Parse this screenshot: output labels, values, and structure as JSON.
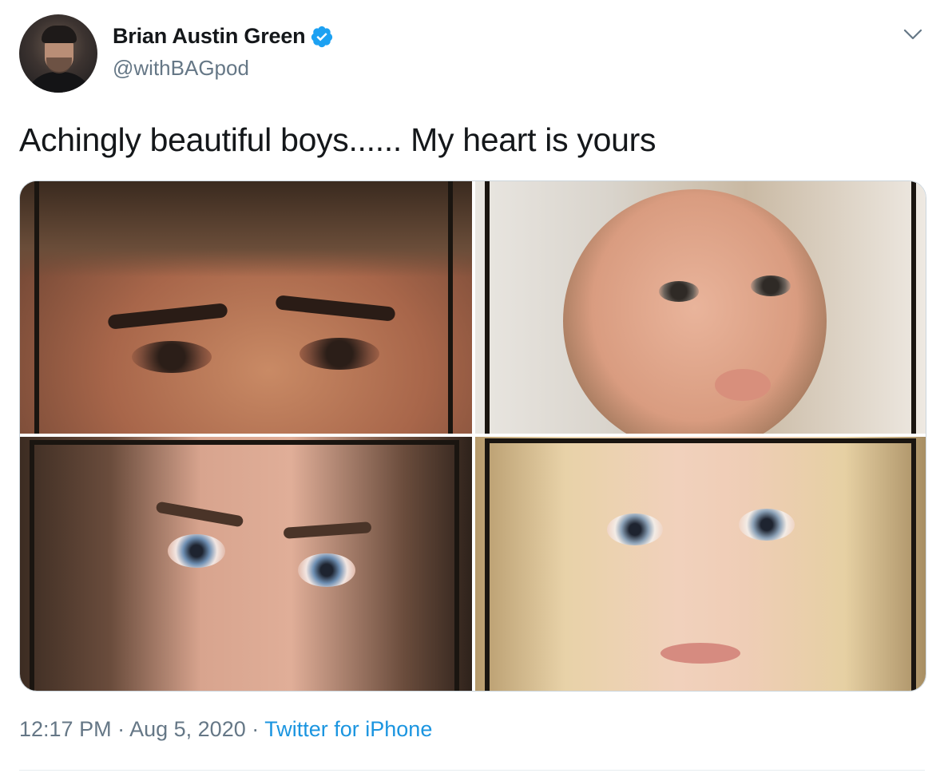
{
  "author": {
    "name": "Brian Austin Green",
    "handle": "@withBAGpod",
    "verified": true,
    "avatar_icon": "profile-photo"
  },
  "tweet": {
    "text": "Achingly beautiful boys...... My heart is yours"
  },
  "media": {
    "count": 4,
    "photos": [
      "photo-1",
      "photo-2",
      "photo-3",
      "photo-4"
    ]
  },
  "footer": {
    "time": "12:17 PM",
    "separator": " · ",
    "date": "Aug 5, 2020",
    "source": "Twitter for iPhone"
  },
  "colors": {
    "text": "#14171a",
    "secondary": "#657786",
    "link": "#1b95e0",
    "verified_badge": "#1da1f2",
    "border": "#ccd6dd"
  },
  "icons": {
    "verified": "verified-badge-icon",
    "more": "chevron-down-icon"
  }
}
